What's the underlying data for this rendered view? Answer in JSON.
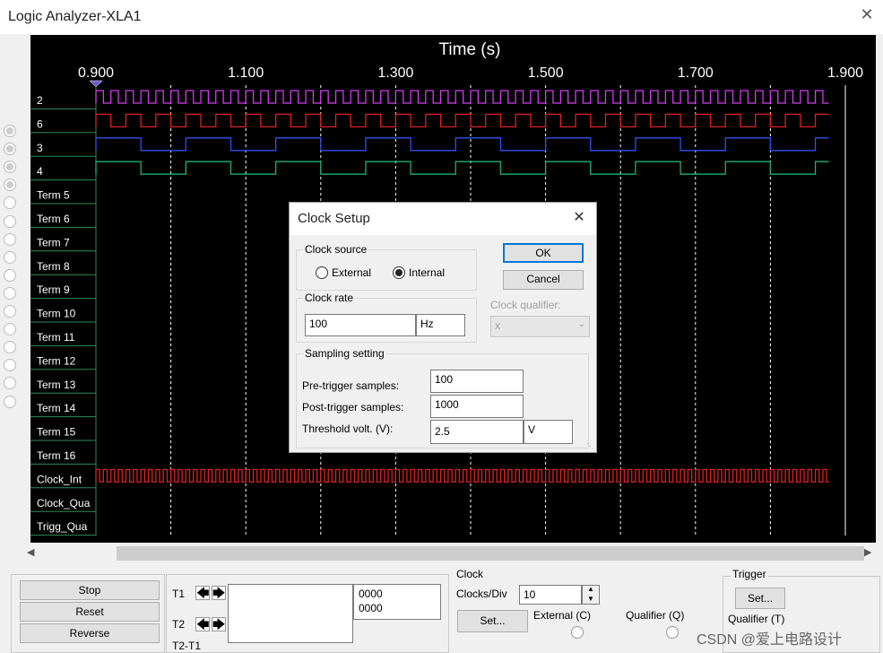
{
  "window": {
    "title": "Logic Analyzer-XLA1",
    "close": "✕"
  },
  "scope": {
    "time_label": "Time (s)",
    "time_ticks": [
      "0.900",
      "1.100",
      "1.300",
      "1.500",
      "1.700",
      "1.900"
    ],
    "channels": [
      "2",
      "6",
      "3",
      "4",
      "Term 5",
      "Term 6",
      "Term 7",
      "Term 8",
      "Term 9",
      "Term 10",
      "Term 11",
      "Term 12",
      "Term 13",
      "Term 14",
      "Term 15",
      "Term 16",
      "Clock_Int",
      "Clock_Qua",
      "Trigg_Qua"
    ],
    "traces": [
      {
        "channel": "2",
        "color": "#d43cf0",
        "period": 0.02
      },
      {
        "channel": "6",
        "color": "#e02020",
        "period": 0.04
      },
      {
        "channel": "3",
        "color": "#3050f0",
        "period": 0.12
      },
      {
        "channel": "4",
        "color": "#20b070",
        "period": 0.12
      },
      {
        "channel": "Clock_Int",
        "color": "#e02020",
        "period": 0.01
      }
    ],
    "colors": {
      "background": "#000000",
      "grid": "#ffffff",
      "divider": "#2e8b57"
    }
  },
  "bottom": {
    "stop": "Stop",
    "reset": "Reset",
    "reverse": "Reverse",
    "t1": "T1",
    "t2": "T2",
    "t2t1": "T2-T1",
    "t1_value": "0000",
    "t2_value": "0000",
    "clock_title": "Clock",
    "clocks_div_label": "Clocks/Div",
    "clocks_div": "10",
    "clock_set": "Set...",
    "external_c": "External (C)",
    "qualifier_q": "Qualifier (Q)",
    "trigger_title": "Trigger",
    "trigger_set": "Set...",
    "qualifier_t": "Qualifier (T)"
  },
  "dialog": {
    "title": "Clock Setup",
    "clock_source": "Clock source",
    "external": "External",
    "internal": "Internal",
    "selected": "Internal",
    "clock_rate": "Clock rate",
    "rate_value": "100",
    "rate_unit": "Hz",
    "ok": "OK",
    "cancel": "Cancel",
    "clock_qualifier": "Clock qualifier:",
    "qualifier_value": "x",
    "sampling": "Sampling setting",
    "pre_label": "Pre-trigger samples:",
    "pre_value": "100",
    "post_label": "Post-trigger samples:",
    "post_value": "1000",
    "threshold_label": "Threshold volt. (V):",
    "threshold_value": "2.5",
    "threshold_unit": "V"
  },
  "watermark": "CSDN @爱上电路设计"
}
